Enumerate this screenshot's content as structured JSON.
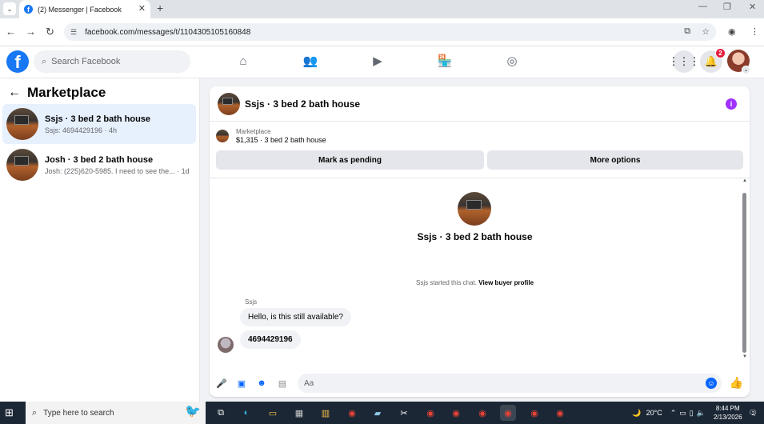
{
  "browser": {
    "tab_title": "(2) Messenger | Facebook",
    "tab_close": "✕",
    "new_tab": "+",
    "url": "facebook.com/messages/t/1104305105160848",
    "window_controls": [
      "—",
      "❐",
      "✕"
    ]
  },
  "fb_header": {
    "logo": "f",
    "search_placeholder": "Search Facebook",
    "notification_count": "2"
  },
  "sidebar": {
    "title": "Marketplace",
    "conversations": [
      {
        "name": "Ssjs · 3 bed 2 bath house",
        "preview": "Ssjs: 4694429196 · 4h"
      },
      {
        "name": "Josh · 3 bed 2 bath house",
        "preview": "Josh: (225)620-5985. I need to see the... · 1d"
      }
    ]
  },
  "chat": {
    "title": "Ssjs · 3 bed 2 bath house",
    "marketplace_label": "Marketplace",
    "listing_price": "$1,315 · 3 bed 2 bath house",
    "mark_pending": "Mark as pending",
    "more_options": "More options",
    "center_title": "Ssjs · 3 bed 2 bath house",
    "started_text": "Ssjs started this chat.",
    "view_buyer_profile": "View buyer profile",
    "sender_label": "Ssjs",
    "messages": [
      "Hello, is this still available?",
      "4694429196"
    ],
    "composer_placeholder": "Aa"
  },
  "taskbar": {
    "search_placeholder": "Type here to search",
    "temperature": "20°C",
    "time": "8:44 PM",
    "date": "2/13/2026",
    "notification_count": "2"
  },
  "colors": {
    "fb_blue": "#1877f2",
    "messenger_blue": "#0866ff",
    "active_conv_bg": "#e7f0fd",
    "info_purple": "#a033ff",
    "badge_red": "#e41e3f"
  }
}
